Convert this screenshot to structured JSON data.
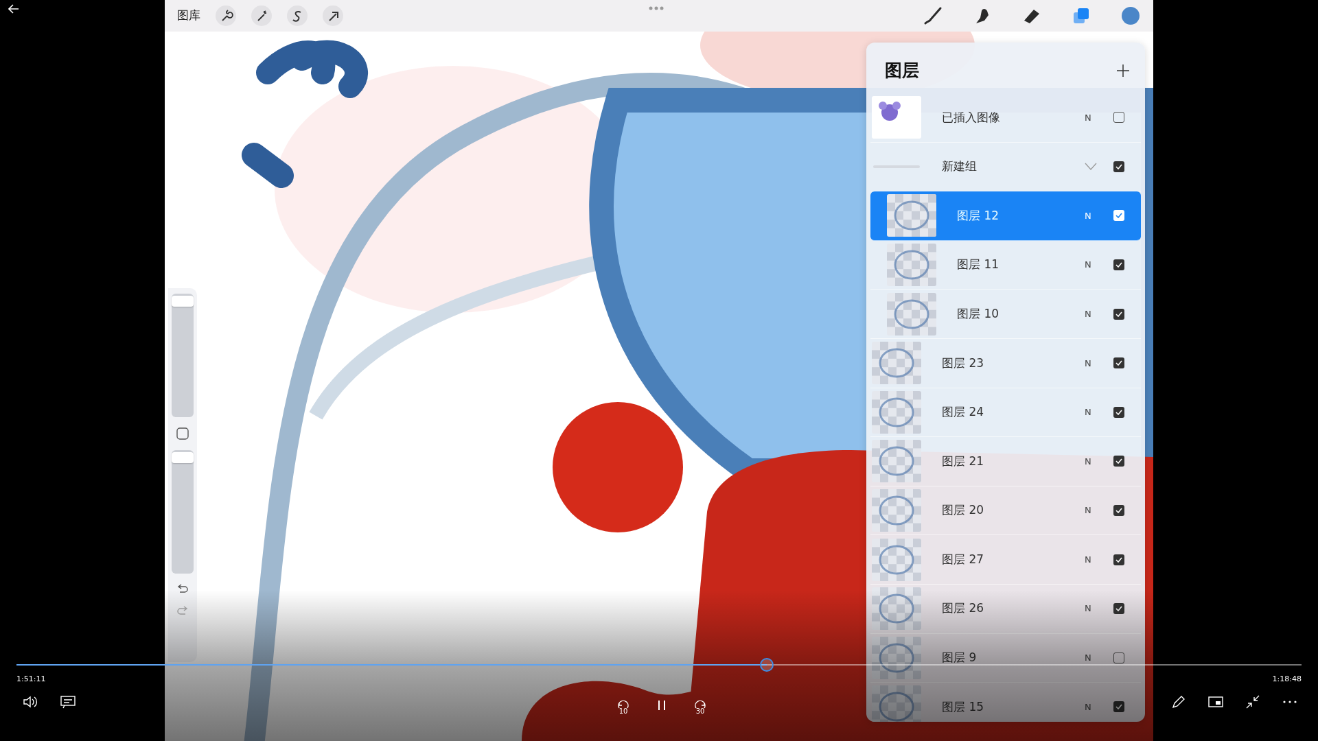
{
  "top_bar": {
    "gallery": "图库",
    "tools": [
      {
        "kind": "brush",
        "selected": false
      },
      {
        "kind": "smudge",
        "selected": false
      },
      {
        "kind": "eraser",
        "selected": false
      },
      {
        "kind": "layers",
        "selected": true
      }
    ],
    "color": "#4a86c8"
  },
  "sidebar": {
    "size_slider": {
      "level": 0.98
    },
    "opacity_slider": {
      "level": 0.98
    }
  },
  "layers_panel": {
    "title": "图层",
    "layers": [
      {
        "kind": "image",
        "name": "已插入图像",
        "blend": "N",
        "visible": false,
        "selected": false
      },
      {
        "kind": "group",
        "name": "新建组",
        "expanded": true,
        "visible": true,
        "selected": false,
        "children": [
          {
            "kind": "layer",
            "name": "图层 12",
            "blend": "N",
            "visible": true,
            "selected": true
          },
          {
            "kind": "layer",
            "name": "图层 11",
            "blend": "N",
            "visible": true,
            "selected": false
          },
          {
            "kind": "layer",
            "name": "图层 10",
            "blend": "N",
            "visible": true,
            "selected": false
          }
        ]
      },
      {
        "kind": "layer",
        "name": "图层 23",
        "blend": "N",
        "visible": true,
        "selected": false
      },
      {
        "kind": "layer",
        "name": "图层 24",
        "blend": "N",
        "visible": true,
        "selected": false
      },
      {
        "kind": "layer",
        "name": "图层 21",
        "blend": "N",
        "visible": true,
        "selected": false
      },
      {
        "kind": "layer",
        "name": "图层 20",
        "blend": "N",
        "visible": true,
        "selected": false
      },
      {
        "kind": "layer",
        "name": "图层 27",
        "blend": "N",
        "visible": true,
        "selected": false
      },
      {
        "kind": "layer",
        "name": "图层 26",
        "blend": "N",
        "visible": true,
        "selected": false
      },
      {
        "kind": "layer",
        "name": "图层 9",
        "blend": "N",
        "visible": false,
        "selected": false
      },
      {
        "kind": "layer",
        "name": "图层 15",
        "blend": "N",
        "visible": true,
        "selected": false
      }
    ]
  },
  "player": {
    "progress": {
      "level": 0.584
    },
    "elapsed": "1:51:11",
    "duration": "1:18:48",
    "skip_back": "10",
    "skip_forward": "30"
  }
}
